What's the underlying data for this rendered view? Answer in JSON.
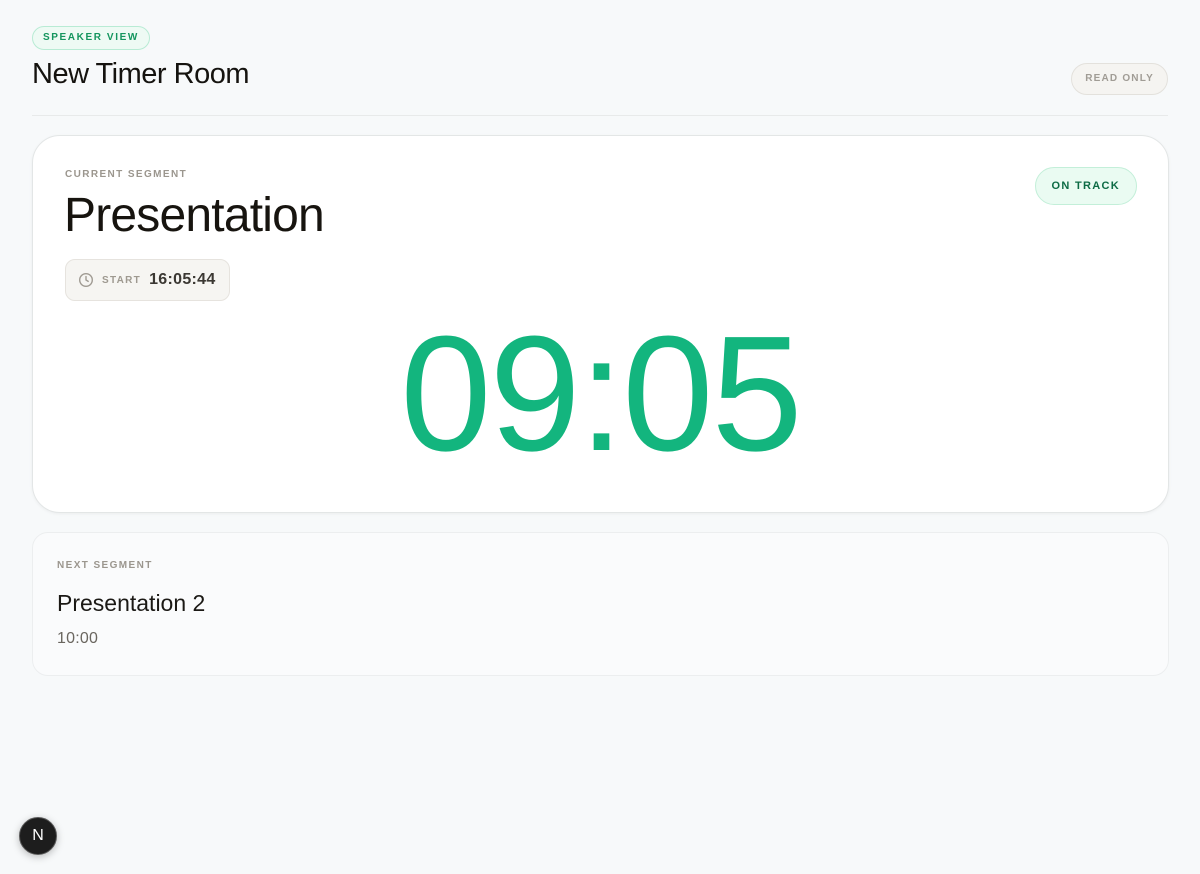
{
  "header": {
    "view_badge": "SPEAKER VIEW",
    "title": "New Timer Room",
    "readonly_badge": "READ ONLY"
  },
  "current": {
    "label": "CURRENT SEGMENT",
    "name": "Presentation",
    "status": "ON TRACK",
    "start_label": "START",
    "start_time": "16:05:44",
    "countdown": "09:05"
  },
  "next": {
    "label": "NEXT SEGMENT",
    "name": "Presentation 2",
    "duration": "10:00"
  },
  "dev_indicator": {
    "glyph": "N",
    "icon": "nextjs-icon"
  },
  "colors": {
    "accent": "#13b57e",
    "status_text": "#0d6b45",
    "background": "#f7f9fa"
  },
  "icons": {
    "start": "clock-icon"
  }
}
